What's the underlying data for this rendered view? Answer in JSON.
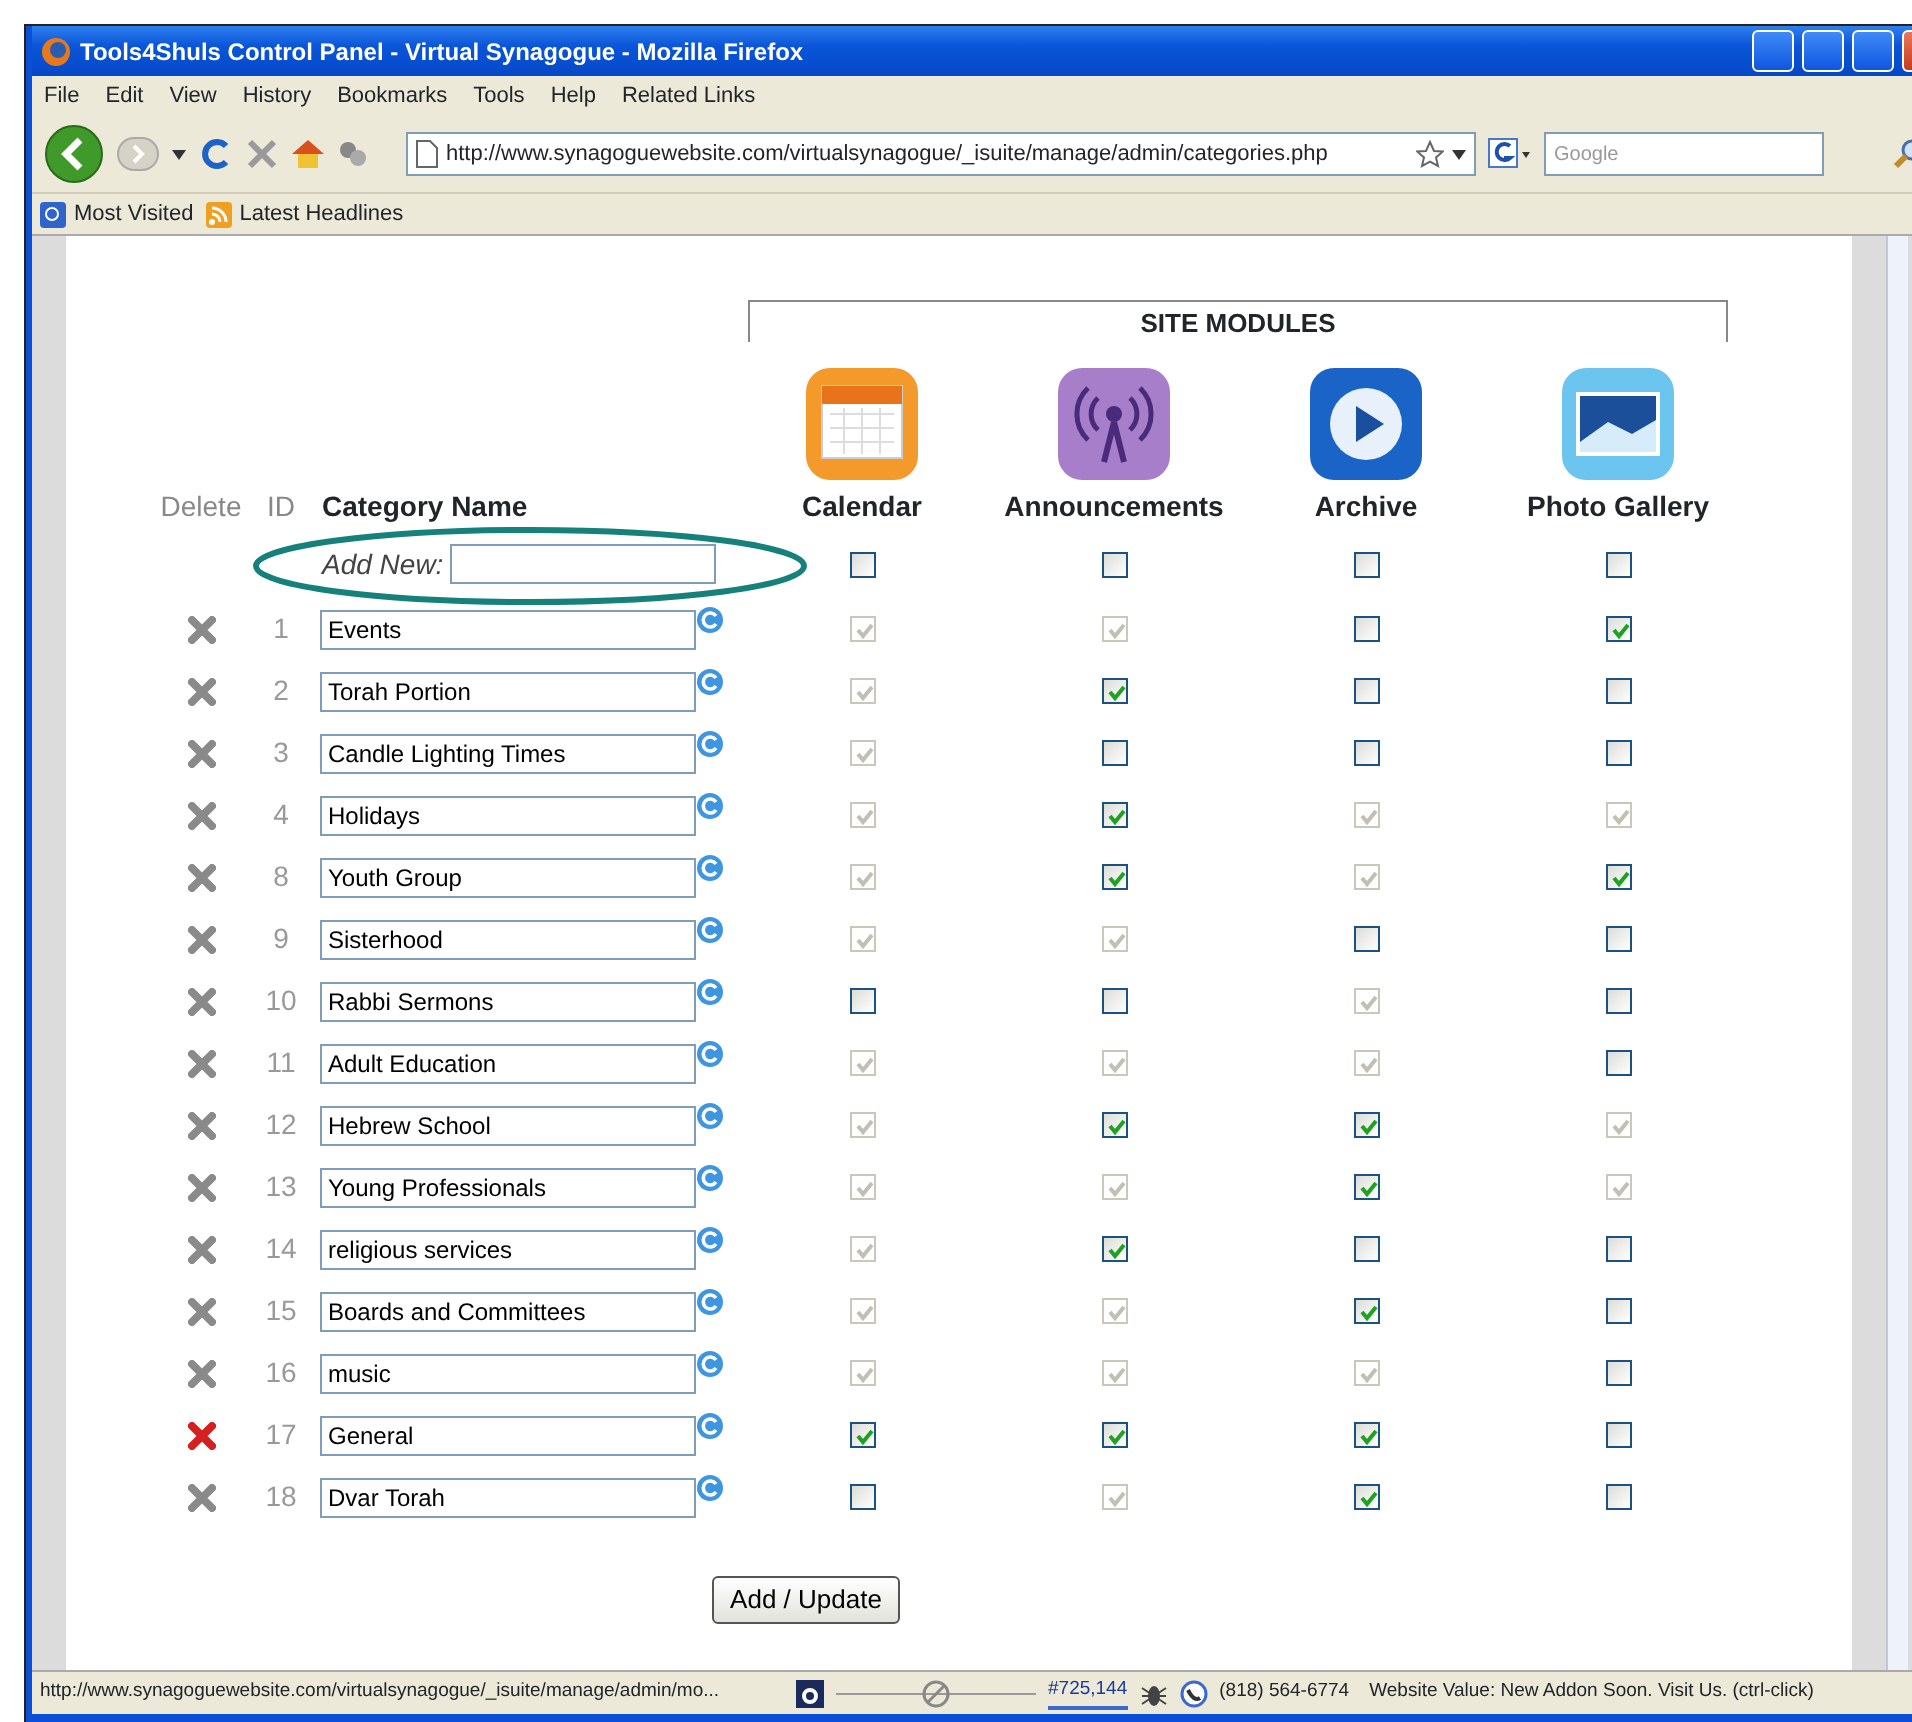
{
  "window": {
    "title": "Tools4Shuls Control Panel - Virtual Synagogue - Mozilla Firefox"
  },
  "menu": [
    "File",
    "Edit",
    "View",
    "History",
    "Bookmarks",
    "Tools",
    "Help",
    "Related Links"
  ],
  "toolbar": {
    "url": "http://www.synagoguewebsite.com/virtualsynagogue/_isuite/manage/admin/categories.php",
    "search_placeholder": "Google"
  },
  "bookmarks": [
    "Most Visited",
    "Latest Headlines"
  ],
  "page": {
    "modules_heading": "SITE MODULES",
    "columns": {
      "delete": "Delete",
      "id": "ID",
      "name": "Category Name"
    },
    "modules": [
      {
        "name": "Calendar",
        "kind": "calendar"
      },
      {
        "name": "Announcements",
        "kind": "broadcast"
      },
      {
        "name": "Archive",
        "kind": "play"
      },
      {
        "name": "Photo Gallery",
        "kind": "photo"
      }
    ],
    "add_new": {
      "label": "Add New:",
      "modules": [
        {
          "checked": false,
          "disabled": false
        },
        {
          "checked": false,
          "disabled": false
        },
        {
          "checked": false,
          "disabled": false
        },
        {
          "checked": false,
          "disabled": false
        }
      ]
    },
    "rows": [
      {
        "id": "1",
        "name": "Events",
        "delete_active": false,
        "modules": [
          {
            "checked": true,
            "disabled": true
          },
          {
            "checked": true,
            "disabled": true
          },
          {
            "checked": false,
            "disabled": false
          },
          {
            "checked": true,
            "disabled": false
          }
        ]
      },
      {
        "id": "2",
        "name": "Torah Portion",
        "delete_active": false,
        "modules": [
          {
            "checked": true,
            "disabled": true
          },
          {
            "checked": true,
            "disabled": false
          },
          {
            "checked": false,
            "disabled": false
          },
          {
            "checked": false,
            "disabled": false
          }
        ]
      },
      {
        "id": "3",
        "name": "Candle Lighting Times",
        "delete_active": false,
        "modules": [
          {
            "checked": true,
            "disabled": true
          },
          {
            "checked": false,
            "disabled": false
          },
          {
            "checked": false,
            "disabled": false
          },
          {
            "checked": false,
            "disabled": false
          }
        ]
      },
      {
        "id": "4",
        "name": "Holidays",
        "delete_active": false,
        "modules": [
          {
            "checked": true,
            "disabled": true
          },
          {
            "checked": true,
            "disabled": false
          },
          {
            "checked": true,
            "disabled": true
          },
          {
            "checked": true,
            "disabled": true
          }
        ]
      },
      {
        "id": "8",
        "name": "Youth Group",
        "delete_active": false,
        "modules": [
          {
            "checked": true,
            "disabled": true
          },
          {
            "checked": true,
            "disabled": false
          },
          {
            "checked": true,
            "disabled": true
          },
          {
            "checked": true,
            "disabled": false
          }
        ]
      },
      {
        "id": "9",
        "name": "Sisterhood",
        "delete_active": false,
        "modules": [
          {
            "checked": true,
            "disabled": true
          },
          {
            "checked": true,
            "disabled": true
          },
          {
            "checked": false,
            "disabled": false
          },
          {
            "checked": false,
            "disabled": false
          }
        ]
      },
      {
        "id": "10",
        "name": "Rabbi Sermons",
        "delete_active": false,
        "modules": [
          {
            "checked": false,
            "disabled": false
          },
          {
            "checked": false,
            "disabled": false
          },
          {
            "checked": true,
            "disabled": true
          },
          {
            "checked": false,
            "disabled": false
          }
        ]
      },
      {
        "id": "11",
        "name": "Adult Education",
        "delete_active": false,
        "modules": [
          {
            "checked": true,
            "disabled": true
          },
          {
            "checked": true,
            "disabled": true
          },
          {
            "checked": true,
            "disabled": true
          },
          {
            "checked": false,
            "disabled": false
          }
        ]
      },
      {
        "id": "12",
        "name": "Hebrew School",
        "delete_active": false,
        "modules": [
          {
            "checked": true,
            "disabled": true
          },
          {
            "checked": true,
            "disabled": false
          },
          {
            "checked": true,
            "disabled": false
          },
          {
            "checked": true,
            "disabled": true
          }
        ]
      },
      {
        "id": "13",
        "name": "Young Professionals",
        "delete_active": false,
        "modules": [
          {
            "checked": true,
            "disabled": true
          },
          {
            "checked": true,
            "disabled": true
          },
          {
            "checked": true,
            "disabled": false
          },
          {
            "checked": true,
            "disabled": true
          }
        ]
      },
      {
        "id": "14",
        "name": "religious services",
        "delete_active": false,
        "modules": [
          {
            "checked": true,
            "disabled": true
          },
          {
            "checked": true,
            "disabled": false
          },
          {
            "checked": false,
            "disabled": false
          },
          {
            "checked": false,
            "disabled": false
          }
        ]
      },
      {
        "id": "15",
        "name": "Boards and Committees",
        "delete_active": false,
        "modules": [
          {
            "checked": true,
            "disabled": true
          },
          {
            "checked": true,
            "disabled": true
          },
          {
            "checked": true,
            "disabled": false
          },
          {
            "checked": false,
            "disabled": false
          }
        ]
      },
      {
        "id": "16",
        "name": "music",
        "delete_active": false,
        "modules": [
          {
            "checked": true,
            "disabled": true
          },
          {
            "checked": true,
            "disabled": true
          },
          {
            "checked": true,
            "disabled": true
          },
          {
            "checked": false,
            "disabled": false
          }
        ]
      },
      {
        "id": "17",
        "name": "General",
        "delete_active": true,
        "modules": [
          {
            "checked": true,
            "disabled": false
          },
          {
            "checked": true,
            "disabled": false
          },
          {
            "checked": true,
            "disabled": false
          },
          {
            "checked": false,
            "disabled": false
          }
        ]
      },
      {
        "id": "18",
        "name": "Dvar Torah",
        "delete_active": false,
        "modules": [
          {
            "checked": false,
            "disabled": false
          },
          {
            "checked": true,
            "disabled": true
          },
          {
            "checked": true,
            "disabled": false
          },
          {
            "checked": false,
            "disabled": false
          }
        ]
      }
    ],
    "submit": "Add / Update",
    "annotations": [
      {
        "kind": "ellipse",
        "color": "#16807b"
      }
    ]
  },
  "status_bar": {
    "url": "http://www.synagoguewebsite.com/virtualsynagogue/_isuite/manage/admin/mo...",
    "rank": "#725,144",
    "phone": "(818) 564-6774",
    "message": "Website Value: New Addon Soon. Visit Us. (ctrl-click)"
  }
}
